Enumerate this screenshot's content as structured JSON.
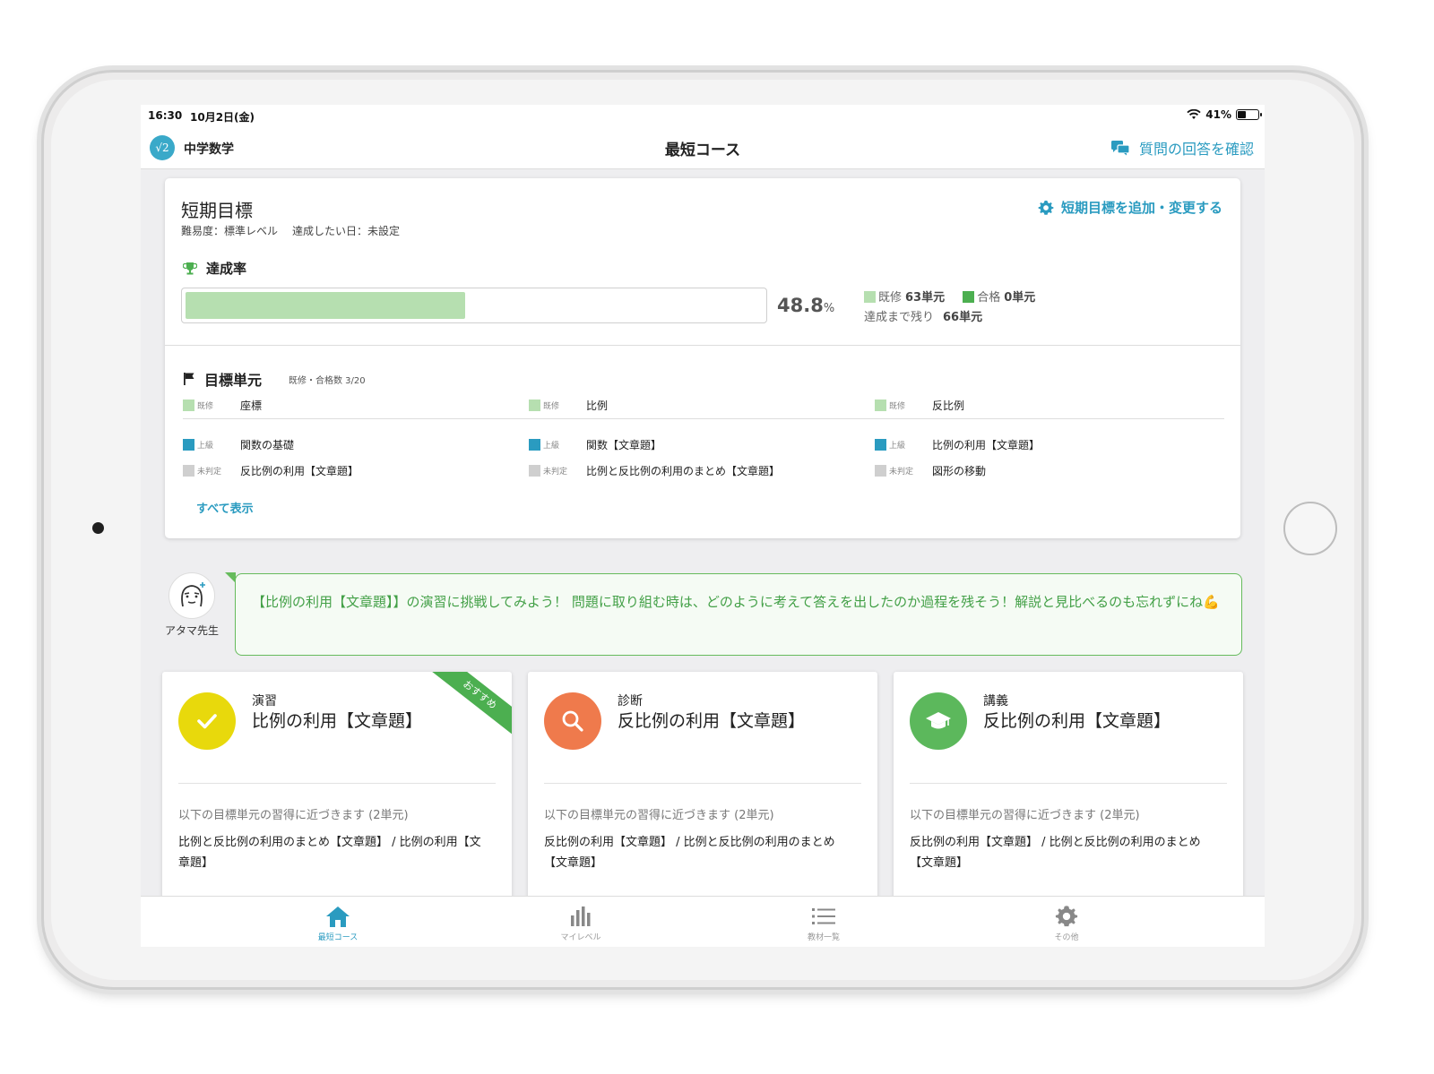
{
  "status": {
    "time": "16:30",
    "date": "10月2日(金)",
    "battery": "41%",
    "battery_level": 0.41
  },
  "header": {
    "subject_icon": "√2",
    "subject": "中学数学",
    "title": "最短コース",
    "qa_link": "質問の回答を確認"
  },
  "goal": {
    "title": "短期目標",
    "difficulty": "難易度：標準レベル",
    "target_date": "達成したい日：未設定",
    "edit_link": "短期目標を追加・変更する",
    "rate_label": "達成率",
    "rate_value": "48.8",
    "rate_unit": "%",
    "rate_fraction": 0.488,
    "learned_label": "既修",
    "learned_value": "63単元",
    "passed_label": "合格",
    "passed_value": "0単元",
    "remaining_label": "達成まで残り",
    "remaining_value": "66単元",
    "colors": {
      "learned": "#b6dfb0",
      "passed": "#4caf50",
      "advanced": "#2a9bc0",
      "undetermined": "#cfcfcf"
    }
  },
  "units": {
    "title": "目標単元",
    "count": "既修・合格数 3/20",
    "rows": [
      [
        {
          "status": "既修",
          "name": "座標"
        },
        {
          "status": "既修",
          "name": "比例"
        },
        {
          "status": "既修",
          "name": "反比例"
        }
      ],
      [
        {
          "status": "上級",
          "name": "関数の基礎"
        },
        {
          "status": "上級",
          "name": "関数【文章題】"
        },
        {
          "status": "上級",
          "name": "比例の利用【文章題】"
        }
      ],
      [
        {
          "status": "未判定",
          "name": "反比例の利用【文章題】"
        },
        {
          "status": "未判定",
          "name": "比例と反比例の利用のまとめ【文章題】"
        },
        {
          "status": "未判定",
          "name": "図形の移動"
        }
      ]
    ],
    "show_all": "すべて表示"
  },
  "teacher": {
    "name": "アタマ先生",
    "message": "【比例の利用【文章題】】の演習に挑戦してみよう！ 問題に取り組む時は、どのように考えて答えを出したのか過程を残そう！解説と見比べるのも忘れずにね💪"
  },
  "activities": [
    {
      "kind": "演習",
      "name": "比例の利用【文章題】",
      "icon": "check-icon",
      "color": "#e8d90c",
      "ribbon": "おすすめ",
      "hint": "以下の目標単元の習得に近づきます (2単元)",
      "targets": "比例と反比例の利用のまとめ【文章題】 / 比例の利用【文章題】"
    },
    {
      "kind": "診断",
      "name": "反比例の利用【文章題】",
      "icon": "search-icon",
      "color": "#ef7a4c",
      "hint": "以下の目標単元の習得に近づきます (2単元)",
      "targets": "反比例の利用【文章題】 / 比例と反比例の利用のまとめ【文章題】"
    },
    {
      "kind": "講義",
      "name": "反比例の利用【文章題】",
      "icon": "graduation-cap-icon",
      "color": "#5cb85c",
      "hint": "以下の目標単元の習得に近づきます (2単元)",
      "targets": "反比例の利用【文章題】 / 比例と反比例の利用のまとめ【文章題】"
    }
  ],
  "tabs": [
    {
      "label": "最短コース",
      "icon": "home-icon",
      "active": true
    },
    {
      "label": "マイレベル",
      "icon": "bar-chart-icon",
      "active": false
    },
    {
      "label": "教材一覧",
      "icon": "list-icon",
      "active": false
    },
    {
      "label": "その他",
      "icon": "gear-icon",
      "active": false
    }
  ]
}
